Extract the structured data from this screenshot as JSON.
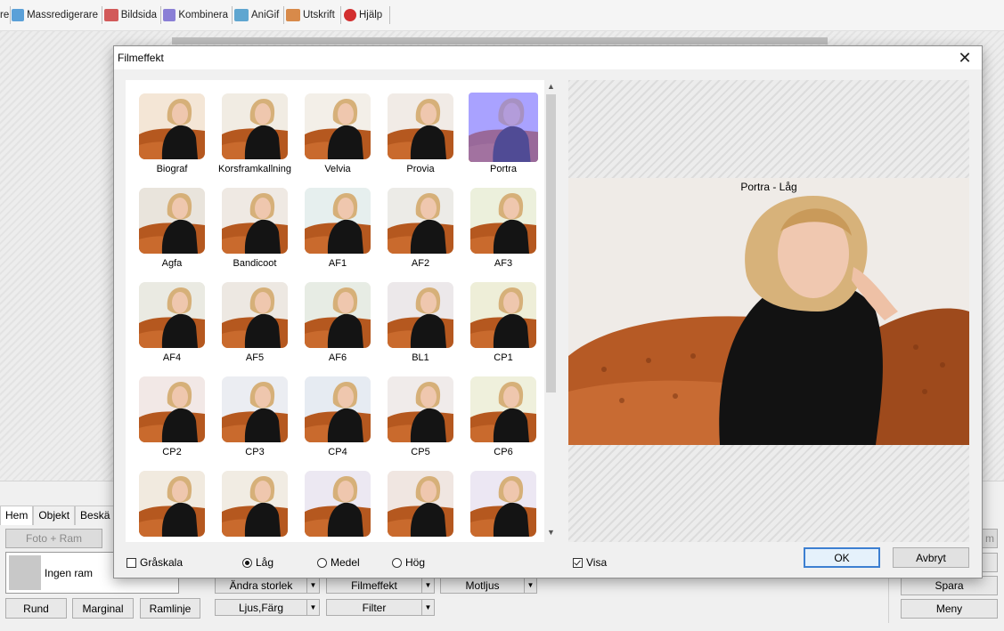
{
  "toolbar": {
    "tabs": [
      {
        "label": "re",
        "icon": "edit-icon"
      },
      {
        "label": "Massredigerare",
        "icon": "batch-edit-icon"
      },
      {
        "label": "Bildsida",
        "icon": "image-page-icon"
      },
      {
        "label": "Kombinera",
        "icon": "combine-icon"
      },
      {
        "label": "AniGif",
        "icon": "anigif-icon"
      },
      {
        "label": "Utskrift",
        "icon": "print-icon"
      },
      {
        "label": "Hjälp",
        "icon": "help-icon"
      }
    ]
  },
  "bottom": {
    "tabs": [
      "Hem",
      "Objekt",
      "Beskä"
    ],
    "photo_frame_btn": "Foto + Ram",
    "frame_name": "Ingen ram",
    "btn_round": "Rund",
    "btn_margin": "Marginal",
    "btn_frameline": "Ramlinje",
    "btn_resize": "Ändra storlek",
    "btn_light_color": "Ljus,Färg",
    "btn_film_effect": "Filmeffekt",
    "btn_filter": "Filter",
    "btn_backlight": "Motljus",
    "btn_partial_right": "m",
    "btn_save": "Spara",
    "btn_menu": "Meny"
  },
  "dialog": {
    "title": "Filmeffekt",
    "effects": [
      "Biograf",
      "Korsframkallning",
      "Velvia",
      "Provia",
      "Portra",
      "Agfa",
      "Bandicoot",
      "AF1",
      "AF2",
      "AF3",
      "AF4",
      "AF5",
      "AF6",
      "BL1",
      "CP1",
      "CP2",
      "CP3",
      "CP4",
      "CP5",
      "CP6",
      "",
      "",
      "",
      "",
      ""
    ],
    "selected_effect": "Portra",
    "preview_title": "Portra - Låg",
    "grayscale_label": "Gråskala",
    "grayscale_checked": false,
    "intensity": {
      "options": [
        "Låg",
        "Medel",
        "Hög"
      ],
      "selected": "Låg"
    },
    "show_label": "Visa",
    "show_checked": true,
    "ok_label": "OK",
    "cancel_label": "Avbryt"
  },
  "colors": {
    "selection_tint": "#8278ff",
    "default_button_border": "#3c7fd1",
    "sofa": "#b4501c",
    "dress": "#111111"
  }
}
